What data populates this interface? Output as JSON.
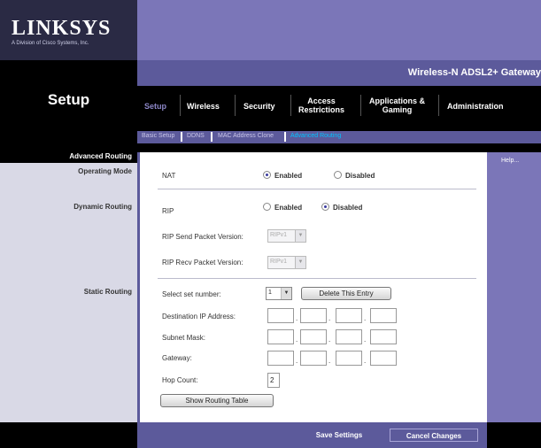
{
  "brand": {
    "logo": "LINKSYS",
    "tagline": "A Division of Cisco Systems, Inc."
  },
  "page_title": "Setup",
  "product_name": "Wireless-N ADSL2+ Gateway",
  "tabs": [
    {
      "label_line1": "Setup",
      "label_line2": ""
    },
    {
      "label_line1": "Wireless",
      "label_line2": ""
    },
    {
      "label_line1": "Security",
      "label_line2": ""
    },
    {
      "label_line1": "Access",
      "label_line2": "Restrictions"
    },
    {
      "label_line1": "Applications &",
      "label_line2": "Gaming"
    },
    {
      "label_line1": "Administration",
      "label_line2": ""
    }
  ],
  "subtabs": [
    "Basic Setup",
    "DDNS",
    "MAC Address Clone",
    "Advanced Routing"
  ],
  "section_title": "Advanced Routing",
  "labels": {
    "operating_mode": "Operating Mode",
    "dynamic_routing": "Dynamic Routing",
    "static_routing": "Static Routing"
  },
  "operating_mode": {
    "label": "NAT",
    "enabled": "Enabled",
    "disabled": "Disabled",
    "selected": "enabled"
  },
  "dynamic_routing": {
    "rip_label": "RIP",
    "enabled": "Enabled",
    "disabled": "Disabled",
    "selected": "disabled",
    "send_version_label": "RIP Send Packet Version:",
    "send_version_value": "RIPv1",
    "recv_version_label": "RIP Recv Packet Version:",
    "recv_version_value": "RIPv1"
  },
  "static_routing": {
    "select_label": "Select set number:",
    "select_value": "1",
    "delete_button": "Delete This Entry",
    "dest_ip_label": "Destination IP Address:",
    "subnet_label": "Subnet Mask:",
    "gateway_label": "Gateway:",
    "hop_label": "Hop Count:",
    "hop_value": "2",
    "show_table_button": "Show Routing Table"
  },
  "help_label": "Help...",
  "footer": {
    "save": "Save Settings",
    "cancel": "Cancel Changes"
  },
  "colors": {
    "purple": "#7b76b8",
    "dark_purple": "#5c5a9b",
    "black": "#000000",
    "active_subtab": "#00c4ff"
  }
}
